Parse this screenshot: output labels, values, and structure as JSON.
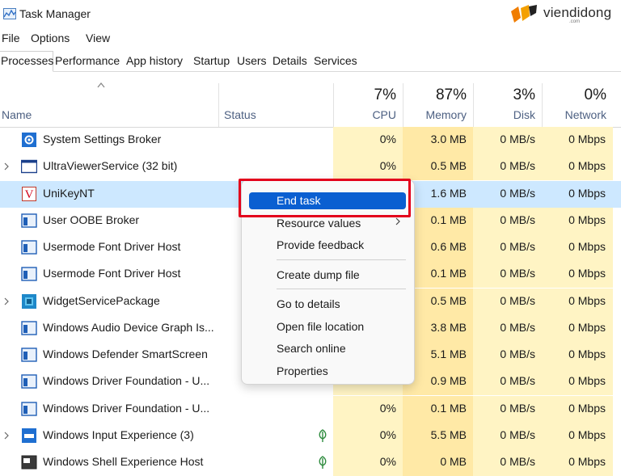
{
  "window": {
    "title": "Task Manager"
  },
  "brand": {
    "name": "viendidong",
    "sub": ".com"
  },
  "menu": [
    "File",
    "Options",
    "View"
  ],
  "tabs": [
    "Processes",
    "Performance",
    "App history",
    "Startup",
    "Users",
    "Details",
    "Services"
  ],
  "columns": {
    "name": "Name",
    "status": "Status",
    "cpu": {
      "pct": "7%",
      "label": "CPU"
    },
    "memory": {
      "pct": "87%",
      "label": "Memory"
    },
    "disk": {
      "pct": "3%",
      "label": "Disk"
    },
    "network": {
      "pct": "0%",
      "label": "Network"
    }
  },
  "processes": [
    {
      "name": "System Settings Broker",
      "icon": "gear-icon",
      "expandable": false,
      "cpu": "0%",
      "memory": "3.0 MB",
      "disk": "0 MB/s",
      "network": "0 Mbps"
    },
    {
      "name": "UltraViewerService (32 bit)",
      "icon": "window-icon",
      "expandable": true,
      "cpu": "0%",
      "memory": "0.5 MB",
      "disk": "0 MB/s",
      "network": "0 Mbps"
    },
    {
      "name": "UniKeyNT",
      "icon": "unikey-icon",
      "expandable": false,
      "cpu": "",
      "memory": "1.6 MB",
      "disk": "0 MB/s",
      "network": "0 Mbps",
      "selected": true
    },
    {
      "name": "User OOBE Broker",
      "icon": "app-window-icon",
      "expandable": false,
      "cpu": "",
      "memory": "0.1 MB",
      "disk": "0 MB/s",
      "network": "0 Mbps"
    },
    {
      "name": "Usermode Font Driver Host",
      "icon": "app-window-icon",
      "expandable": false,
      "cpu": "",
      "memory": "0.6 MB",
      "disk": "0 MB/s",
      "network": "0 Mbps"
    },
    {
      "name": "Usermode Font Driver Host",
      "icon": "app-window-icon",
      "expandable": false,
      "cpu": "",
      "memory": "0.1 MB",
      "disk": "0 MB/s",
      "network": "0 Mbps"
    },
    {
      "name": "WidgetServicePackage",
      "icon": "widget-icon",
      "expandable": true,
      "cpu": "",
      "memory": "0.5 MB",
      "disk": "0 MB/s",
      "network": "0 Mbps"
    },
    {
      "name": "Windows Audio Device Graph Is...",
      "icon": "app-window-icon",
      "expandable": false,
      "cpu": "",
      "memory": "3.8 MB",
      "disk": "0 MB/s",
      "network": "0 Mbps"
    },
    {
      "name": "Windows Defender SmartScreen",
      "icon": "app-window-icon",
      "expandable": false,
      "cpu": "",
      "memory": "5.1 MB",
      "disk": "0 MB/s",
      "network": "0 Mbps"
    },
    {
      "name": "Windows Driver Foundation - U...",
      "icon": "app-window-icon",
      "expandable": false,
      "cpu": "",
      "memory": "0.9 MB",
      "disk": "0 MB/s",
      "network": "0 Mbps"
    },
    {
      "name": "Windows Driver Foundation - U...",
      "icon": "app-window-icon",
      "expandable": false,
      "cpu": "0%",
      "memory": "0.1 MB",
      "disk": "0 MB/s",
      "network": "0 Mbps"
    },
    {
      "name": "Windows Input Experience (3)",
      "icon": "input-icon",
      "expandable": true,
      "cpu": "0%",
      "memory": "5.5 MB",
      "disk": "0 MB/s",
      "network": "0 Mbps",
      "suspended": true
    },
    {
      "name": "Windows Shell Experience Host",
      "icon": "shell-icon",
      "expandable": false,
      "cpu": "0%",
      "memory": "0 MB",
      "disk": "0 MB/s",
      "network": "0 Mbps",
      "suspended": true
    }
  ],
  "context_menu": {
    "items": [
      "End task",
      "Resource values",
      "Provide feedback",
      "Create dump file",
      "Go to details",
      "Open file location",
      "Search online",
      "Properties"
    ]
  },
  "colors": {
    "accent": "#0a5fd1",
    "cpu_heat": "#fff4c4",
    "memory_heat": "#ffe9a6",
    "selected_row": "#cde8ff",
    "highlight_box": "#e3001b"
  }
}
